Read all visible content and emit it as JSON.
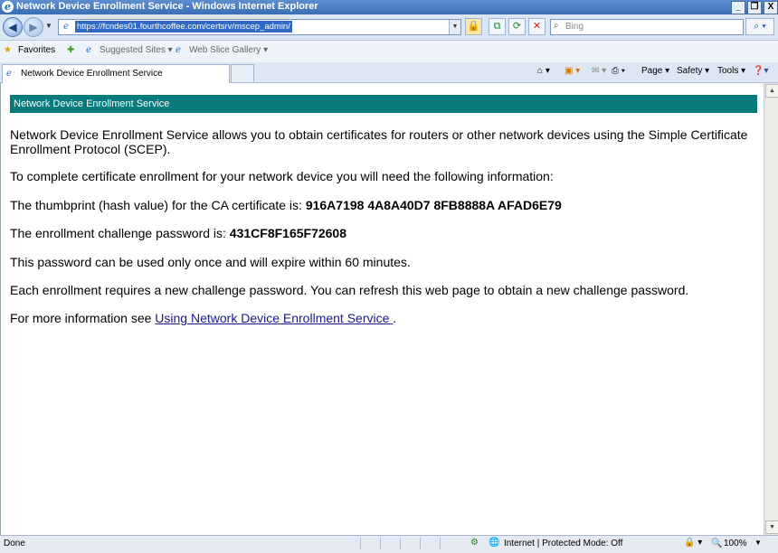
{
  "window": {
    "title": "Network Device Enrollment Service - Windows Internet Explorer",
    "minimize": "_",
    "restore": "❐",
    "close": "X"
  },
  "address": {
    "url": "https://fcndes01.fourthcoffee.com/certsrv/mscep_admin/"
  },
  "search": {
    "placeholder": "Bing"
  },
  "favorites": {
    "label": "Favorites",
    "items": [
      "Suggested Sites ▾",
      "Web Slice Gallery ▾"
    ]
  },
  "tab": {
    "label": "Network Device Enrollment Service"
  },
  "commands": [
    "Page ▾",
    "Safety ▾",
    "Tools ▾"
  ],
  "page": {
    "banner": "Network Device Enrollment Service",
    "intro": "Network Device Enrollment Service allows you to obtain certificates for routers or other network devices using the Simple Certificate Enrollment Protocol (SCEP).",
    "need_info": "To complete certificate enrollment for your network device you will need the following information:",
    "thumb_label": "The thumbprint (hash value) for the CA certificate is: ",
    "thumb_value": "916A7198 4A8A40D7 8FB8888A AFAD6E79",
    "pw_label": "The enrollment challenge password is: ",
    "pw_value": "431CF8F165F72608",
    "pw_note": "This password can be used only once and will expire within 60 minutes.",
    "refresh_note": "Each enrollment requires a new challenge password. You can refresh this web page to obtain a new challenge password.",
    "more_prefix": "For more information see ",
    "more_link": "Using Network Device Enrollment Service ",
    "more_suffix": "."
  },
  "status": {
    "left": "Done",
    "zone": "Internet | Protected Mode: Off",
    "zoom": "100%"
  }
}
